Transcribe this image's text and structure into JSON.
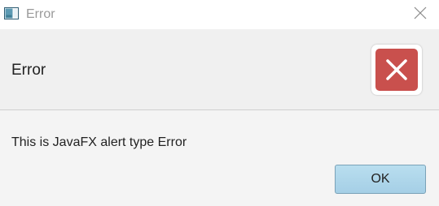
{
  "window": {
    "title": "Error",
    "app_icon": "javafx-window-icon",
    "close_icon": "close-icon"
  },
  "header": {
    "text": "Error",
    "graphic_icon": "error-x-icon",
    "graphic_color": "#c9504d"
  },
  "content": {
    "text": "This is JavaFX alert type Error"
  },
  "buttons": {
    "ok_label": "OK",
    "ok_color": "#b9deef"
  }
}
